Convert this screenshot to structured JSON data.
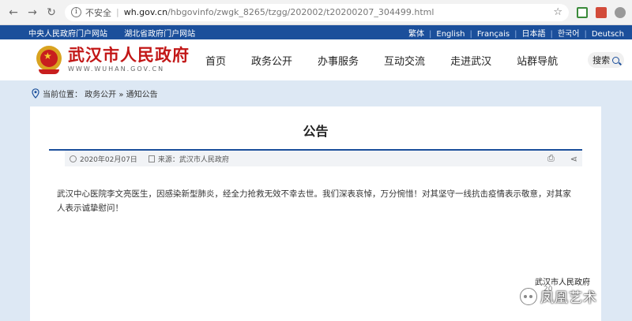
{
  "browser": {
    "security_label": "不安全",
    "url_host": "wh.gov.cn",
    "url_path": "/hbgovinfo/zwgk_8265/tzgg/202002/t20200207_304499.html"
  },
  "topbar": {
    "links": [
      "中央人民政府门户网站",
      "湖北省政府门户网站"
    ],
    "languages": [
      "繁体",
      "English",
      "Français",
      "日本語",
      "한국어",
      "Deutsch"
    ]
  },
  "header": {
    "site_name_cn": "武汉市人民政府",
    "site_name_en": "WWW.WUHAN.GOV.CN",
    "nav": [
      "首页",
      "政务公开",
      "办事服务",
      "互动交流",
      "走进武汉",
      "站群导航"
    ],
    "search_label": "搜索"
  },
  "breadcrumb": {
    "text": "当前位置： 政务公开 » 通知公告"
  },
  "article": {
    "title": "公告",
    "date": "2020年02月07日",
    "source": "来源：武汉市人民政府",
    "body": "武汉中心医院李文亮医生，因感染新型肺炎，经全力抢救无效不幸去世。我们深表哀悼，万分惋惜！对其坚守一线抗击疫情表示敬意，对其家人表示诚挚慰问！"
  },
  "watermark": {
    "small_text": "武汉市人民政府",
    "small_sub": "20",
    "main_text": "凤凰艺术"
  }
}
